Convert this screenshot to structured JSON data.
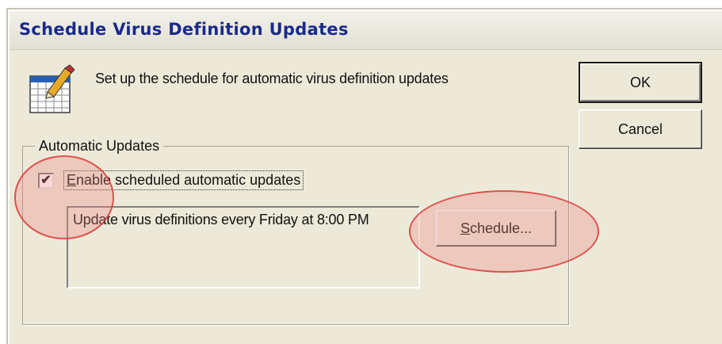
{
  "dialog": {
    "title": "Schedule Virus Definition Updates",
    "intro": "Set up the schedule for automatic virus definition updates",
    "icon": "calendar-icon"
  },
  "buttons": {
    "ok_label": "OK",
    "cancel_label": "Cancel",
    "schedule_label_rest": "chedule...",
    "schedule_label_mnemonic": "S"
  },
  "group": {
    "label": "Automatic Updates",
    "checkbox_mnemonic": "E",
    "checkbox_label_rest": "nable scheduled automatic updates",
    "checkbox_checked": true,
    "schedule_summary": "Update virus definitions every Friday at 8:00 PM"
  },
  "colors": {
    "dialog_bg": "#ece9d8",
    "title_text": "#1a2a8a",
    "highlight": "#e06060"
  }
}
